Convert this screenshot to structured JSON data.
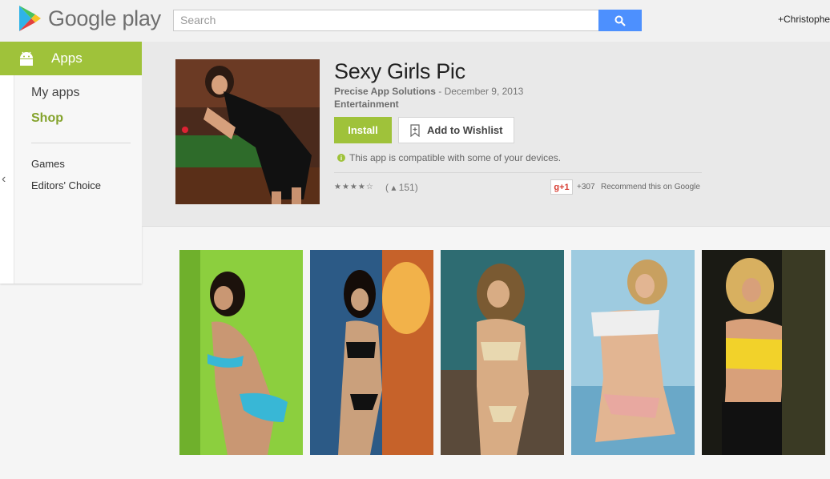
{
  "header": {
    "logo_text": "Google play",
    "search": {
      "placeholder": "Search"
    },
    "user_name": "+Christophe"
  },
  "sidebar": {
    "section": "Apps",
    "items": [
      {
        "label": "My apps",
        "active": false
      },
      {
        "label": "Shop",
        "active": true
      }
    ],
    "sub_items": [
      {
        "label": "Games"
      },
      {
        "label": "Editors' Choice"
      }
    ],
    "collapse_glyph": "‹"
  },
  "app": {
    "title": "Sexy Girls Pic",
    "developer": "Precise App Solutions",
    "separator_date": " - December 9, 2013",
    "category": "Entertainment",
    "install_label": "Install",
    "wishlist_label": "Add to Wishlist",
    "compat_icon": "i",
    "compat_text": "This app is compatible with some of your devices.",
    "stars_display": "★★★★☆",
    "rating_value": 4.5,
    "rating_count": "( ▴ 151)",
    "gplus_label": "g+1",
    "gplus_count": "+307",
    "recommend_text": "Recommend this on Google"
  },
  "colors": {
    "brand_green": "#9fc23a",
    "search_blue": "#4d90fe",
    "header_bg": "#f1f1f1",
    "details_bg": "#e9e9e9"
  },
  "icons": {
    "logo": "google-play-triangle-icon",
    "search": "search-icon",
    "apps": "android-icon",
    "wishlist": "bookmark-plus-icon",
    "compat": "info-icon",
    "user": "person-icon"
  },
  "screenshots_count": 5
}
